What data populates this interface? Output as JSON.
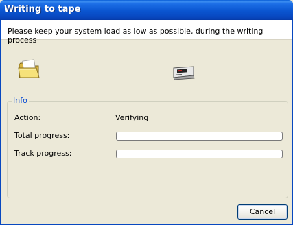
{
  "window": {
    "title": "Writing to tape"
  },
  "header": {
    "instruction": "Please keep your system load as low as possible, during the writing process"
  },
  "icons": {
    "source": "folder-icon",
    "destination": "tape-drive-icon"
  },
  "info": {
    "legend": "Info",
    "action_label": "Action:",
    "action_value": "Verifying",
    "total_label": "Total progress:",
    "total_progress": 0,
    "track_label": "Track progress:",
    "track_progress": 0
  },
  "buttons": {
    "cancel": "Cancel"
  },
  "colors": {
    "title_bar": "#0a55d0",
    "legend_text": "#0046d5",
    "window_bg": "#ece9d8"
  }
}
